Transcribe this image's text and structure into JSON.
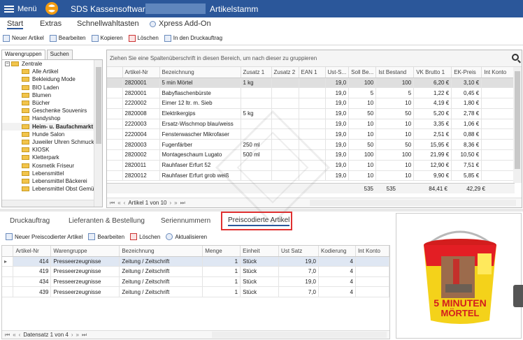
{
  "titlebar": {
    "menu_label": "Menü",
    "app_name": "SDS Kassensoftware",
    "window_title": "Artikelstamm"
  },
  "ribbon": {
    "tabs": [
      "Start",
      "Extras",
      "Schnellwahltasten",
      "Xpress Add-On"
    ],
    "toolbar": [
      "Neuer Artikel",
      "Bearbeiten",
      "Kopieren",
      "Löschen",
      "In den Druckauftrag"
    ]
  },
  "left_panel": {
    "tabs": [
      "Warengruppen",
      "Suchen"
    ],
    "tree": [
      {
        "label": "Zentrale",
        "level": 0
      },
      {
        "label": "Alle Artikel",
        "level": 1
      },
      {
        "label": "Bekleidung Mode",
        "level": 1
      },
      {
        "label": "BIO Laden",
        "level": 1
      },
      {
        "label": "Blumen",
        "level": 1
      },
      {
        "label": "Bücher",
        "level": 1
      },
      {
        "label": "Geschenke Souvenirs",
        "level": 1
      },
      {
        "label": "Handyshop",
        "level": 1
      },
      {
        "label": "Heim- u. Baufachmarkt",
        "level": 1,
        "selected": true
      },
      {
        "label": "Hunde Salon",
        "level": 1
      },
      {
        "label": "Juweiler Uhren Schmuck",
        "level": 1
      },
      {
        "label": "KIOSK",
        "level": 1
      },
      {
        "label": "Kletterpark",
        "level": 1
      },
      {
        "label": "Kosmetik Friseur",
        "level": 1
      },
      {
        "label": "Lebensmittel",
        "level": 1
      },
      {
        "label": "Lebensmittel Bäckerei",
        "level": 1
      },
      {
        "label": "Lebensmittel Obst Gemü",
        "level": 1
      }
    ]
  },
  "grid1": {
    "group_hint": "Ziehen Sie eine Spaltenüberschrift in diesen Bereich, um nach dieser zu gruppieren",
    "columns": [
      "Artikel-Nr",
      "Bezeichnung",
      "Zusatz 1",
      "Zusatz 2",
      "EAN 1",
      "Ust-S...",
      "Soll Be...",
      "Ist Bestand",
      "VK Brutto 1",
      "EK-Preis",
      "Int Konto"
    ],
    "rows": [
      [
        "2820001",
        "5 min Mörtel",
        "1 kg",
        "",
        "",
        "19,0",
        "100",
        "100",
        "6,20 €",
        "3,10 €",
        ""
      ],
      [
        "2820001",
        "Babyflaschenbürste",
        "",
        "",
        "",
        "19,0",
        "5",
        "5",
        "1,22 €",
        "0,45 €",
        ""
      ],
      [
        "2220002",
        "Eimer 12 ltr. m. Sieb",
        "",
        "",
        "",
        "19,0",
        "10",
        "10",
        "4,19 €",
        "1,80 €",
        ""
      ],
      [
        "2820008",
        "Elektrikergips",
        "5 kg",
        "",
        "",
        "19,0",
        "50",
        "50",
        "5,20 €",
        "2,78 €",
        ""
      ],
      [
        "2220003",
        "Ersatz-Wischmop blau/weiss",
        "",
        "",
        "",
        "19,0",
        "10",
        "10",
        "3,35 €",
        "1,06 €",
        ""
      ],
      [
        "2220004",
        "Fensterwascher Mikrofaser",
        "",
        "",
        "",
        "19,0",
        "10",
        "10",
        "2,51 €",
        "0,88 €",
        ""
      ],
      [
        "2820003",
        "Fugenfärber",
        "250 ml",
        "",
        "",
        "19,0",
        "50",
        "50",
        "15,95 €",
        "8,36 €",
        ""
      ],
      [
        "2820002",
        "Montageschaum Lugato",
        "500 ml",
        "",
        "",
        "19,0",
        "100",
        "100",
        "21,99 €",
        "10,50 €",
        ""
      ],
      [
        "2820011",
        "Rauhfaser Erfurt 52",
        "",
        "",
        "",
        "19,0",
        "10",
        "10",
        "12,90 €",
        "7,51 €",
        ""
      ],
      [
        "2820012",
        "Rauhfaser Erfurt grob weiß",
        "",
        "",
        "",
        "19,0",
        "10",
        "10",
        "9,90 €",
        "5,85 €",
        ""
      ]
    ],
    "summary": {
      "soll": "535",
      "ist": "535",
      "vk": "84,41 €",
      "ek": "42,29 €"
    },
    "nav_text": "Artikel 1 von 10"
  },
  "bottom": {
    "tabs": [
      "Druckauftrag",
      "Lieferanten & Bestellung",
      "Seriennummern",
      "Preiscodierte Artikel"
    ],
    "toolbar": [
      "Neuer Preiscodierter Artikel",
      "Bearbeiten",
      "Löschen",
      "Aktualisieren"
    ],
    "columns": [
      "Artikel-Nr",
      "Warengruppe",
      "Bezeichnung",
      "Menge",
      "Einheit",
      "Ust Satz",
      "Kodierung",
      "Int Konto"
    ],
    "rows": [
      [
        "414",
        "Presseerzeugnisse",
        "Zeitung / Zeitschrift",
        "1",
        "Stück",
        "19,0",
        "4",
        ""
      ],
      [
        "419",
        "Presseerzeugnisse",
        "Zeitung / Zeitschrift",
        "1",
        "Stück",
        "7,0",
        "4",
        ""
      ],
      [
        "434",
        "Presseerzeugnisse",
        "Zeitung / Zeitschrift",
        "1",
        "Stück",
        "19,0",
        "4",
        ""
      ],
      [
        "439",
        "Presseerzeugnisse",
        "Zeitung / Zeitschrift",
        "1",
        "Stück",
        "7,0",
        "4",
        ""
      ]
    ],
    "nav_text": "Datensatz 1 von 4"
  },
  "product_image": {
    "caption_line1": "5 MINUTEN",
    "caption_line2": "MÖRTEL"
  },
  "colors": {
    "titlebar": "#2b579a",
    "highlight_box": "#e03030",
    "row_selected": "#dfdfdf"
  }
}
